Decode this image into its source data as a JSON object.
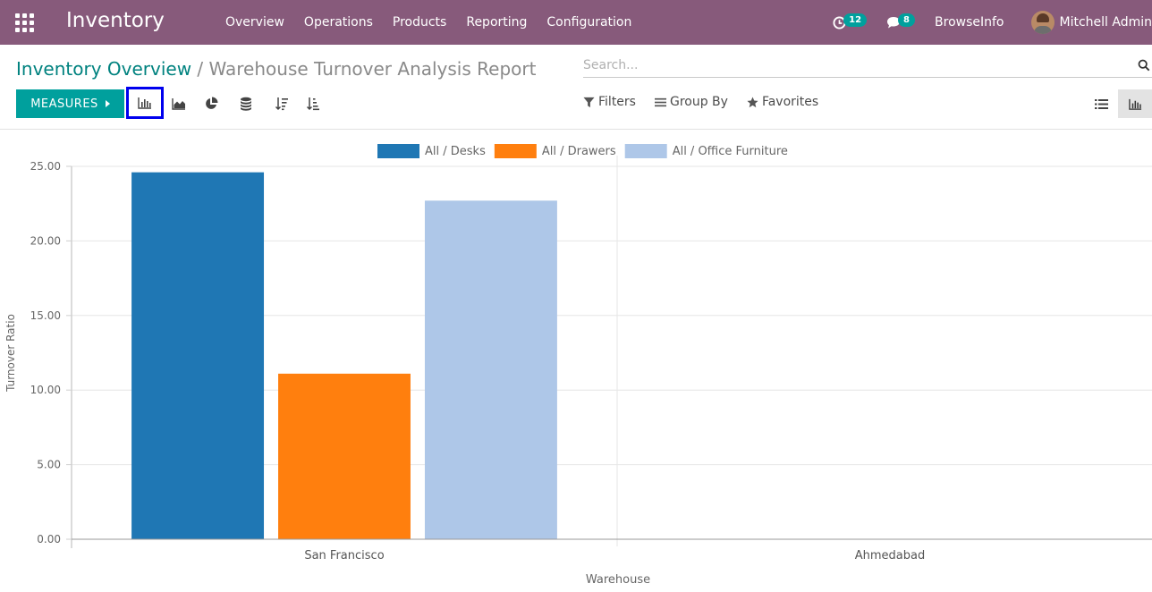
{
  "navbar": {
    "app_name": "Inventory",
    "menu": [
      "Overview",
      "Operations",
      "Products",
      "Reporting",
      "Configuration"
    ],
    "activity_count": "12",
    "message_count": "8",
    "company": "BrowseInfo",
    "user": "Mitchell Admin"
  },
  "control_panel": {
    "breadcrumb_parent": "Inventory Overview",
    "breadcrumb_separator": "/",
    "breadcrumb_current": "Warehouse Turnover Analysis Report",
    "search_placeholder": "Search...",
    "measures_label": "MEASURES",
    "filters_label": "Filters",
    "group_by_label": "Group By",
    "favorites_label": "Favorites"
  },
  "colors": {
    "navbar": "#875a7b",
    "accent": "#00a09d",
    "desks": "#1f77b4",
    "drawers": "#ff7f0e",
    "office_furniture": "#aec7e8"
  },
  "chart_data": {
    "type": "bar",
    "categories": [
      "San Francisco",
      "Ahmedabad"
    ],
    "series": [
      {
        "name": "All / Desks",
        "values": [
          24.6,
          0
        ],
        "color": "#1f77b4"
      },
      {
        "name": "All / Drawers",
        "values": [
          11.1,
          0
        ],
        "color": "#ff7f0e"
      },
      {
        "name": "All / Office Furniture",
        "values": [
          22.7,
          0
        ],
        "color": "#aec7e8"
      }
    ],
    "xlabel": "Warehouse",
    "ylabel": "Turnover Ratio",
    "ylim": [
      0,
      25
    ],
    "yticks": [
      "0.00",
      "5.00",
      "10.00",
      "15.00",
      "20.00",
      "25.00"
    ],
    "grid": true,
    "legend": "top-center"
  }
}
